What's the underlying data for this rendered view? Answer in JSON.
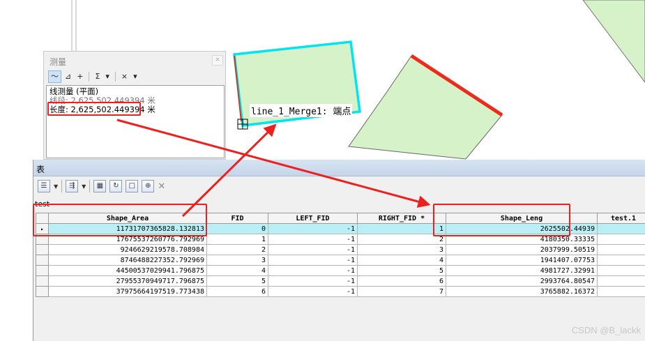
{
  "measure": {
    "title": "测量",
    "close": "×",
    "tools": [
      "〜",
      "⊿",
      "+",
      "Σ",
      "▾",
      "×",
      "▾"
    ],
    "mode_line": "线测量 (平面)",
    "segment_line": "线段: 2,625,502.449394 米",
    "length_line": "长度: 2,625,502.449394 米"
  },
  "map": {
    "feature_label": "line_1_Merge1: 端点"
  },
  "table_window": {
    "title": "表",
    "table_name": "test",
    "columns": [
      "Shape_Area",
      "FID",
      "LEFT_FID",
      "RIGHT_FID *",
      "Shape_Leng",
      "test.1"
    ],
    "rows": [
      {
        "Shape_Area": "11731707365828.132813",
        "FID": "0",
        "LEFT_FID": "-1",
        "RIGHT_FID": "1",
        "Shape_Leng": "2625502.44939"
      },
      {
        "Shape_Area": "17675537260776.792969",
        "FID": "1",
        "LEFT_FID": "-1",
        "RIGHT_FID": "2",
        "Shape_Leng": "4180350.33335"
      },
      {
        "Shape_Area": "9246629219578.708984",
        "FID": "2",
        "LEFT_FID": "-1",
        "RIGHT_FID": "3",
        "Shape_Leng": "2037999.50519"
      },
      {
        "Shape_Area": "8746488227352.792969",
        "FID": "3",
        "LEFT_FID": "-1",
        "RIGHT_FID": "4",
        "Shape_Leng": "1941407.07753"
      },
      {
        "Shape_Area": "44500537029941.796875",
        "FID": "4",
        "LEFT_FID": "-1",
        "RIGHT_FID": "5",
        "Shape_Leng": "4981727.32991"
      },
      {
        "Shape_Area": "27955370949717.796875",
        "FID": "5",
        "LEFT_FID": "-1",
        "RIGHT_FID": "6",
        "Shape_Leng": "2993764.80547"
      },
      {
        "Shape_Area": "37975664197519.773438",
        "FID": "6",
        "LEFT_FID": "-1",
        "RIGHT_FID": "7",
        "Shape_Leng": "3765882.16372"
      }
    ],
    "selected_row": 0,
    "row_marker": "▸"
  },
  "watermark": "CSDN @B_lackk",
  "colors": {
    "annotation": "#ee1f1f",
    "polygon_fill": "#d6f2c8",
    "selection": "#00e5f0",
    "selected_row": "#b9f0f8"
  }
}
